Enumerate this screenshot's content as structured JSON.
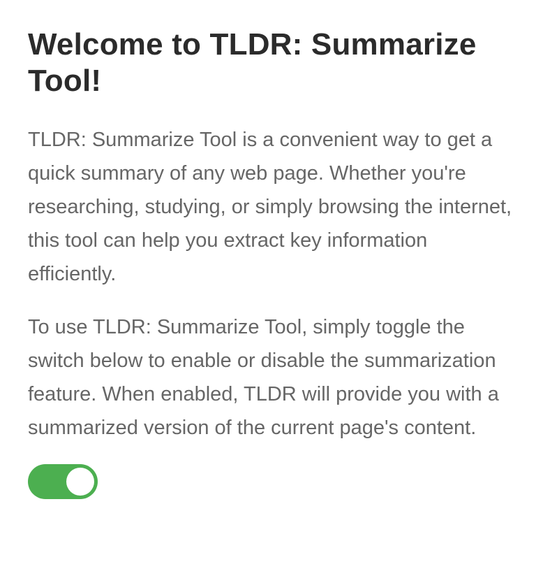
{
  "page": {
    "title": "Welcome to TLDR: Summarize Tool!",
    "intro": "TLDR: Summarize Tool is a convenient way to get a quick summary of any web page. Whether you're researching, studying, or simply browsing the internet, this tool can help you extract key information efficiently.",
    "instructions": "To use TLDR: Summarize Tool, simply toggle the switch below to enable or disable the summarization feature. When enabled, TLDR will provide you with a summarized version of the current page's content."
  },
  "toggle": {
    "state": "on",
    "on_color": "#4caf50",
    "knob_color": "#ffffff"
  },
  "colors": {
    "heading": "#2b2b2b",
    "body_text": "#666666",
    "background": "#ffffff"
  }
}
